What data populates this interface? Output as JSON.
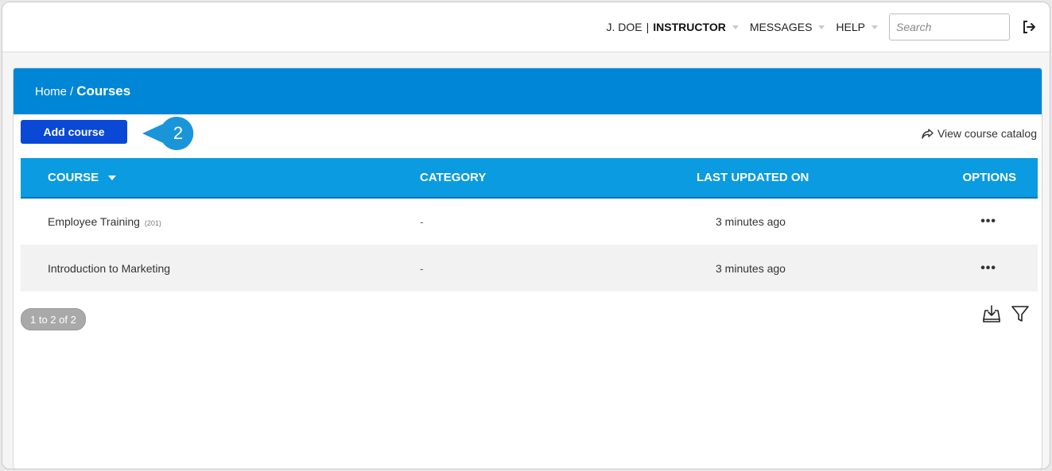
{
  "topbar": {
    "user": "J. DOE",
    "separator": "|",
    "role": "INSTRUCTOR",
    "messages": "MESSAGES",
    "help": "HELP",
    "search_placeholder": "Search"
  },
  "breadcrumb": {
    "home": "Home",
    "separator": "/",
    "current": "Courses"
  },
  "actions": {
    "add_course": "Add course",
    "callout_number": "2",
    "view_catalog": "View course catalog"
  },
  "table": {
    "headers": [
      "COURSE",
      "CATEGORY",
      "LAST UPDATED ON",
      "OPTIONS"
    ],
    "rows": [
      {
        "course": "Employee Training",
        "count": "(201)",
        "category": "-",
        "updated": "3 minutes ago",
        "options": "•••"
      },
      {
        "course": "Introduction to Marketing",
        "count": "",
        "category": "-",
        "updated": "3 minutes ago",
        "options": "•••"
      }
    ]
  },
  "pagination": "1 to 2 of 2",
  "colors": {
    "header_band": "#0086d6",
    "table_header": "#0a9be0",
    "add_button": "#0a48d6",
    "callout": "#1a95d9"
  },
  "icons": {
    "logout": "logout-icon",
    "share": "share-arrow-icon",
    "download": "download-icon",
    "filter": "filter-icon"
  }
}
